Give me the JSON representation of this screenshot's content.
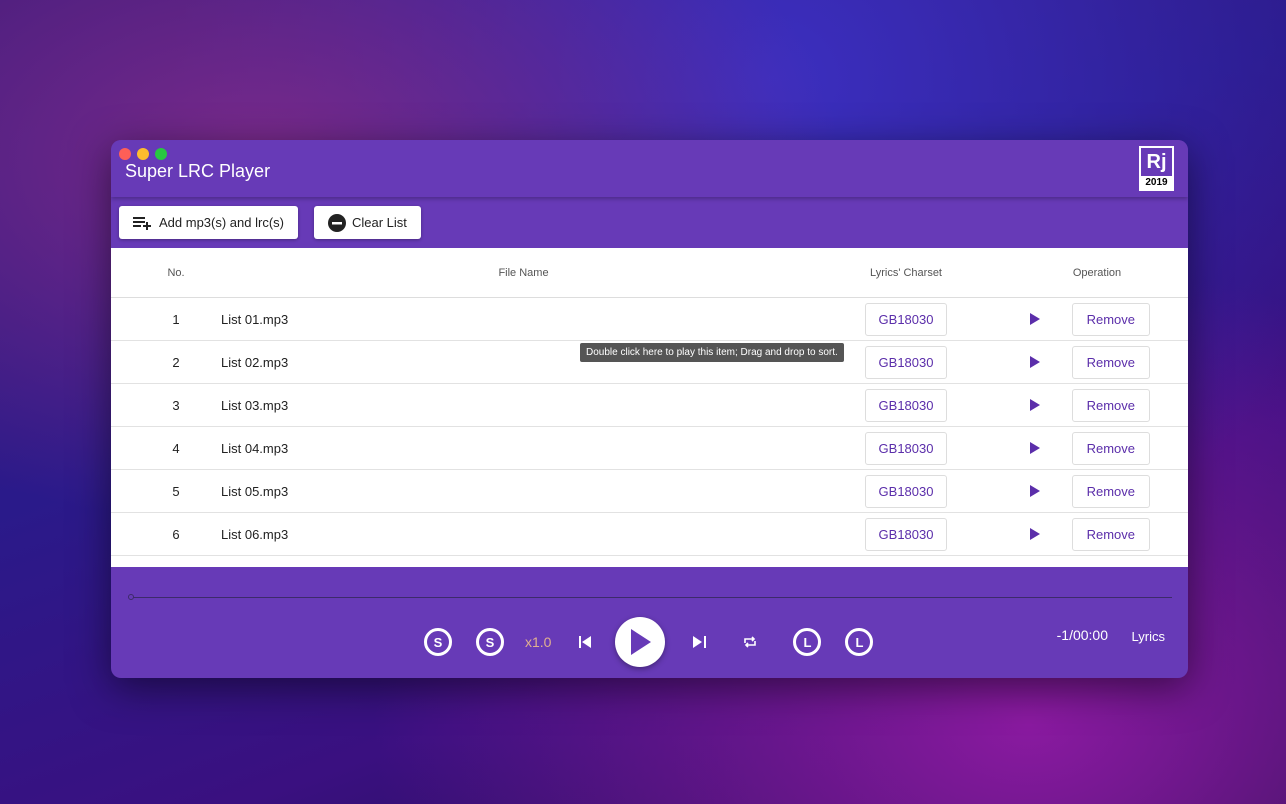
{
  "window": {
    "title": "Super LRC Player",
    "logo": {
      "letters": "Rj",
      "year": "2019"
    }
  },
  "toolbar": {
    "add_label": "Add mp3(s) and lrc(s)",
    "clear_label": "Clear List"
  },
  "table": {
    "headers": {
      "no": "No.",
      "file": "File Name",
      "charset": "Lyrics' Charset",
      "op": "Operation"
    },
    "rows": [
      {
        "no": "1",
        "file": "List 01.mp3",
        "charset": "GB18030",
        "remove": "Remove"
      },
      {
        "no": "2",
        "file": "List 02.mp3",
        "charset": "GB18030",
        "remove": "Remove"
      },
      {
        "no": "3",
        "file": "List 03.mp3",
        "charset": "GB18030",
        "remove": "Remove"
      },
      {
        "no": "4",
        "file": "List 04.mp3",
        "charset": "GB18030",
        "remove": "Remove"
      },
      {
        "no": "5",
        "file": "List 05.mp3",
        "charset": "GB18030",
        "remove": "Remove"
      },
      {
        "no": "6",
        "file": "List 06.mp3",
        "charset": "GB18030",
        "remove": "Remove"
      }
    ]
  },
  "tooltip": "Double click here to play this item; Drag and drop to sort.",
  "player": {
    "speed": "x1.0",
    "time": "-1/00:00",
    "lyrics_label": "Lyrics",
    "progress": 0,
    "s_letter": "S",
    "l_letter": "L"
  },
  "colors": {
    "accent": "#673ab7",
    "speed": "#e0b090"
  }
}
